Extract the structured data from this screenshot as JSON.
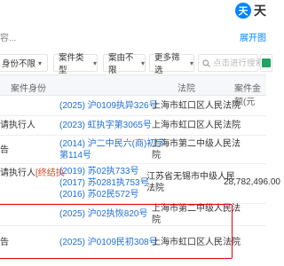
{
  "header": {
    "logo_mark": "天",
    "logo_text": "天",
    "description_text": "容...",
    "expand_link": "展开图"
  },
  "filters": {
    "role": "身份不限",
    "case_type": "案件类型",
    "case_reason": "案由不限",
    "more": "更多筛选",
    "search_placeholder": "点击进行搜索"
  },
  "table": {
    "headers": {
      "role": "案件身份",
      "court": "法院",
      "amount": "案件金额(元"
    },
    "rows": [
      {
        "role": "",
        "tag": "",
        "case_numbers": [
          "(2025) 沪0109执异326号"
        ],
        "court": [
          "上海市虹口区人民法院"
        ],
        "amount": ""
      },
      {
        "role": "请执行人",
        "tag": "",
        "case_numbers": [
          "(2023) 虹执字第3065号"
        ],
        "court": [
          "上海市虹口区人民法院"
        ],
        "amount": ""
      },
      {
        "role": "告",
        "tag": "",
        "case_numbers": [
          "(2014) 沪二中民六(商)初字",
          "第114号"
        ],
        "court": [
          "上海市第二中级人民法",
          "院"
        ],
        "amount": ""
      },
      {
        "role": "请执行人",
        "tag": "[终结执",
        "case_numbers": [
          "(2019) 苏02执733号",
          "(2017) 苏0281执753号",
          "(2016) 苏02民572号"
        ],
        "court": [
          "江苏省无锡市中级人民",
          "法院"
        ],
        "amount": "28,782,496.00"
      },
      {
        "role": "",
        "tag": "",
        "case_numbers": [
          "(2025) 沪02执恢820号"
        ],
        "court": [
          "上海市第二中级人民法",
          "院"
        ],
        "amount": ""
      },
      {
        "role": "告",
        "tag": "",
        "case_numbers": [
          "(2025) 沪0109民初308号"
        ],
        "court": [
          "上海市虹口区人民法院"
        ],
        "amount": "-"
      }
    ]
  }
}
